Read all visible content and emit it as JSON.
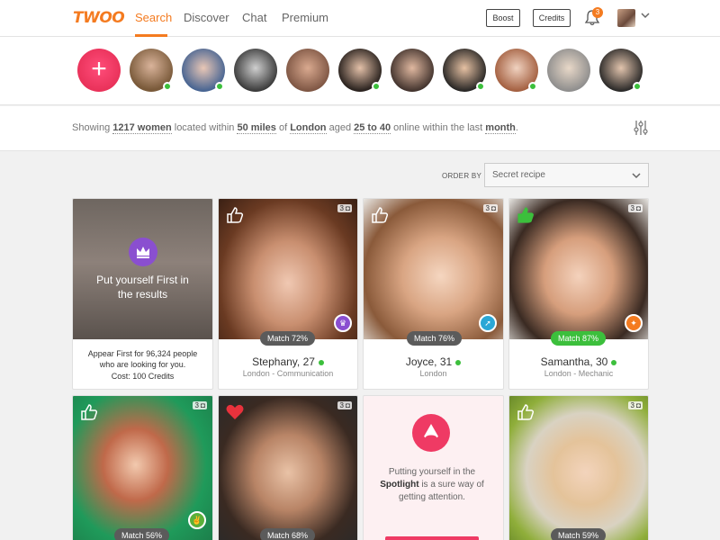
{
  "brand": {
    "logo_text": "TWOO",
    "accent": "#f47b20"
  },
  "nav": {
    "tabs": [
      {
        "label": "Search",
        "active": true
      },
      {
        "label": "Discover",
        "active": false
      },
      {
        "label": "Chat",
        "active": false
      },
      {
        "label": "Premium",
        "active": false
      }
    ],
    "boost_label": "Boost",
    "credits_label": "Credits",
    "notification_count": "3"
  },
  "strip": {
    "add_icon": "plus-icon",
    "people": [
      {
        "online": true
      },
      {
        "online": true
      },
      {
        "online": false
      },
      {
        "online": false
      },
      {
        "online": true
      },
      {
        "online": false
      },
      {
        "online": true
      },
      {
        "online": true
      },
      {
        "online": false
      },
      {
        "online": true
      }
    ]
  },
  "filter": {
    "showing": "Showing",
    "count": "1217 women",
    "located_within": "located within",
    "distance": "50 miles",
    "of": "of",
    "city": "London",
    "aged": "aged",
    "age_range": "25 to 40",
    "online_within": "online within the last",
    "period": "month",
    "end": "."
  },
  "order": {
    "label": "ORDER BY",
    "selected": "Secret recipe"
  },
  "cards": {
    "promo": {
      "headline": "Put yourself First in the results",
      "sub1": "Appear First for 96,324 people who are looking for you.",
      "cost": "Cost: 100 Credits"
    },
    "profiles": [
      {
        "name": "Stephany, 27",
        "sub": "London - Communication",
        "match": "Match 72%",
        "photos": "3",
        "online": true
      },
      {
        "name": "Joyce, 31",
        "sub": "London",
        "match": "Match 76%",
        "photos": "3",
        "online": true
      },
      {
        "name": "Samantha, 30",
        "sub": "London - Mechanic",
        "match": "Match 87%",
        "photos": "3",
        "online": true
      },
      {
        "match": "Match 56%",
        "photos": "3"
      },
      {
        "match": "Match 68%",
        "photos": "3"
      },
      {
        "match": "Match 59%",
        "photos": "3"
      }
    ],
    "spotlight": {
      "text_before": "Putting yourself in the",
      "bold": "Spotlight",
      "text_after": "is a sure way of getting attention."
    }
  }
}
